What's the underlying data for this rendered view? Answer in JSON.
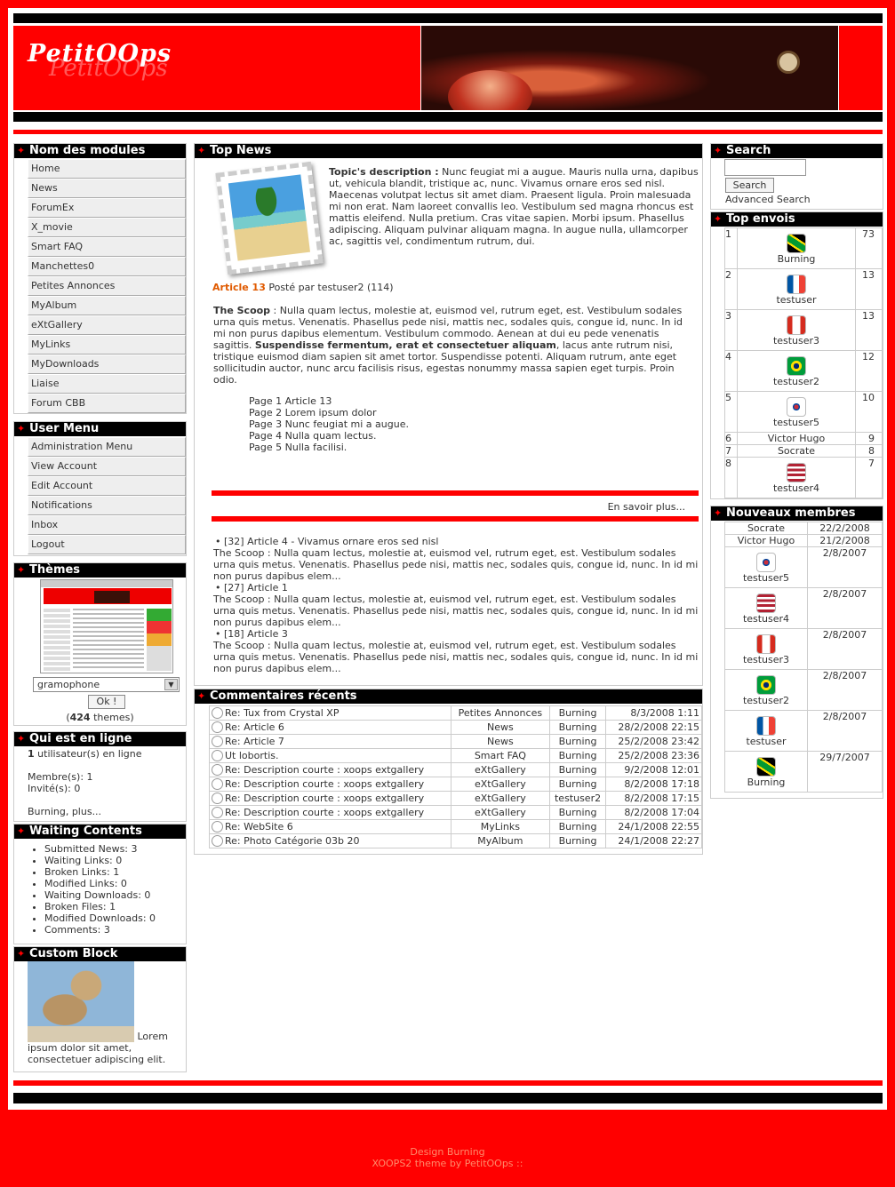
{
  "header": {
    "logo": "PetitOOps"
  },
  "left": {
    "modules": {
      "title": "Nom des modules",
      "items": [
        "Home",
        "News",
        "ForumEx",
        "X_movie",
        "Smart FAQ",
        "Manchettes0",
        "Petites Annonces",
        "MyAlbum",
        "eXtGallery",
        "MyLinks",
        "MyDownloads",
        "Liaise",
        "Forum CBB"
      ]
    },
    "usermenu": {
      "title": "User Menu",
      "items": [
        "Administration Menu",
        "View Account",
        "Edit Account",
        "Notifications",
        "Inbox",
        "Logout"
      ]
    },
    "themes": {
      "title": "Thèmes",
      "selected": "gramophone",
      "ok": "Ok !",
      "count_open": "(",
      "count": "424",
      "count_close": " themes)"
    },
    "online": {
      "title": "Qui est en ligne",
      "count": "1",
      "count_text": " utilisateur(s) en ligne",
      "members": "Membre(s): 1",
      "guests": "Invité(s): 0",
      "more": "Burning, plus..."
    },
    "waiting": {
      "title": "Waiting Contents",
      "items": [
        "Submitted News: 3",
        "Waiting Links: 0",
        "Broken Links: 1",
        "Modified Links: 0",
        "Waiting Downloads: 0",
        "Broken Files: 1",
        "Modified Downloads: 0",
        "Comments: 3"
      ]
    },
    "custom": {
      "title": "Custom Block",
      "text": "Lorem ipsum dolor sit amet, consectetuer adipiscing elit."
    }
  },
  "center": {
    "topnews": {
      "title": "Top News",
      "desc_label": "Topic's description :",
      "desc": " Nunc feugiat mi a augue. Mauris nulla urna, dapibus ut, vehicula blandit, tristique ac, nunc. Vivamus ornare eros sed nisl. Maecenas volutpat lectus sit amet diam. Praesent ligula. Proin malesuada mi non erat. Nam laoreet convallis leo. Vestibulum sed magna rhoncus est mattis eleifend. Nulla pretium. Cras vitae sapien. Morbi ipsum. Phasellus adipiscing. Aliquam pulvinar aliquam magna. In augue nulla, ullamcorper ac, sagittis vel, condimentum rutrum, dui.",
      "article_title": "Article 13",
      "posted": " Posté par testuser2 (114)",
      "scoop_label": "The Scoop",
      "scoop1": " : Nulla quam lectus, molestie at, euismod vel, rutrum eget, est. Vestibulum sodales urna quis metus. Venenatis. Phasellus pede nisi, mattis nec, sodales quis, congue id, nunc. In id mi non purus dapibus elementum. Vestibulum commodo. Aenean at dui eu pede venenatis sagittis. ",
      "scoop_bold": "Suspendisse fermentum, erat et consectetuer aliquam",
      "scoop2": ", lacus ante rutrum nisi, tristique euismod diam sapien sit amet tortor. Suspendisse potenti. Aliquam rutrum, ante eget sollicitudin auctor, nunc arcu facilisis risus, egestas nonummy massa sapien eget turpis. Proin odio.",
      "pages": [
        "Page 1 Article 13",
        "Page 2 Lorem ipsum dolor",
        "Page 3 Nunc feugiat mi a augue.",
        "Page 4 Nulla quam lectus.",
        "Page 5 Nulla facilisi."
      ],
      "more": "En savoir plus...",
      "others": [
        {
          "head": "[32] Article 4 - Vivamus ornare eros sed nisl",
          "body": "The Scoop : Nulla quam lectus, molestie at, euismod vel, rutrum eget, est. Vestibulum sodales urna quis metus. Venenatis. Phasellus pede nisi, mattis nec, sodales quis, congue id, nunc. In id mi non purus dapibus elem..."
        },
        {
          "head": "[27] Article 1",
          "body": "The Scoop : Nulla quam lectus, molestie at, euismod vel, rutrum eget, est. Vestibulum sodales urna quis metus. Venenatis. Phasellus pede nisi, mattis nec, sodales quis, congue id, nunc. In id mi non purus dapibus elem..."
        },
        {
          "head": "[18] Article 3",
          "body": "The Scoop : Nulla quam lectus, molestie at, euismod vel, rutrum eget, est. Vestibulum sodales urna quis metus. Venenatis. Phasellus pede nisi, mattis nec, sodales quis, congue id, nunc. In id mi non purus dapibus elem..."
        }
      ]
    },
    "comments": {
      "title": "Commentaires récents",
      "rows": [
        [
          "Re: Tux from Crystal XP",
          "Petites Annonces",
          "Burning",
          "8/3/2008 1:11"
        ],
        [
          "Re: Article 6",
          "News",
          "Burning",
          "28/2/2008 22:15"
        ],
        [
          "Re: Article 7",
          "News",
          "Burning",
          "25/2/2008 23:42"
        ],
        [
          "Ut lobortis.",
          "Smart FAQ",
          "Burning",
          "25/2/2008 23:36"
        ],
        [
          "Re: Description courte : xoops extgallery",
          "eXtGallery",
          "Burning",
          "9/2/2008 12:01"
        ],
        [
          "Re: Description courte : xoops extgallery",
          "eXtGallery",
          "Burning",
          "8/2/2008 17:18"
        ],
        [
          "Re: Description courte : xoops extgallery",
          "eXtGallery",
          "testuser2",
          "8/2/2008 17:15"
        ],
        [
          "Re: Description courte : xoops extgallery",
          "eXtGallery",
          "Burning",
          "8/2/2008 17:04"
        ],
        [
          "Re: WebSite 6",
          "MyLinks",
          "Burning",
          "24/1/2008 22:55"
        ],
        [
          "Re: Photo Catégorie 03b 20",
          "MyAlbum",
          "Burning",
          "24/1/2008 22:27"
        ]
      ]
    }
  },
  "right": {
    "search": {
      "title": "Search",
      "button": "Search",
      "advanced": "Advanced Search"
    },
    "topenvois": {
      "title": "Top envois",
      "rows": [
        {
          "rank": "1",
          "name": "Burning",
          "count": "73",
          "flag": "jamaica-flag-icon"
        },
        {
          "rank": "2",
          "name": "testuser",
          "count": "13",
          "flag": "france-flag-icon"
        },
        {
          "rank": "3",
          "name": "testuser3",
          "count": "13",
          "flag": "canada-flag-icon"
        },
        {
          "rank": "4",
          "name": "testuser2",
          "count": "12",
          "flag": "brazil-flag-icon"
        },
        {
          "rank": "5",
          "name": "testuser5",
          "count": "10",
          "flag": "korea-flag-icon"
        },
        {
          "rank": "6",
          "name": "Victor Hugo",
          "count": "9",
          "flag": ""
        },
        {
          "rank": "7",
          "name": "Socrate",
          "count": "8",
          "flag": ""
        },
        {
          "rank": "8",
          "name": "testuser4",
          "count": "7",
          "flag": "usa-flag-icon"
        }
      ]
    },
    "newmembers": {
      "title": "Nouveaux membres",
      "rows": [
        {
          "name": "Socrate",
          "date": "22/2/2008",
          "flag": ""
        },
        {
          "name": "Victor Hugo",
          "date": "21/2/2008",
          "flag": ""
        },
        {
          "name": "testuser5",
          "date": "2/8/2007",
          "flag": "korea-flag-icon"
        },
        {
          "name": "testuser4",
          "date": "2/8/2007",
          "flag": "usa-flag-icon"
        },
        {
          "name": "testuser3",
          "date": "2/8/2007",
          "flag": "canada-flag-icon"
        },
        {
          "name": "testuser2",
          "date": "2/8/2007",
          "flag": "brazil-flag-icon"
        },
        {
          "name": "testuser",
          "date": "2/8/2007",
          "flag": "france-flag-icon"
        },
        {
          "name": "Burning",
          "date": "29/7/2007",
          "flag": "jamaica-flag-icon"
        }
      ]
    }
  },
  "footer": {
    "design": "Design Burning",
    "theme": "XOOPS2 theme by PetitOOps ::"
  }
}
